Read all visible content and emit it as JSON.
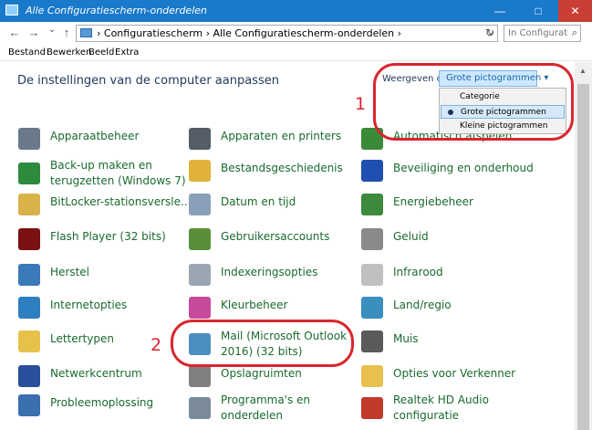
{
  "window": {
    "title": "Alle Configuratiescherm-onderdelen",
    "minimize": "—",
    "maximize": "□",
    "close": "✕"
  },
  "nav": {
    "back": "←",
    "forward": "→",
    "recent": "⌄",
    "up": "↑",
    "breadcrumb": "›  Configuratiescherm  ›  Alle Configuratiescherm-onderdelen  ›",
    "address_dropdown": "⌄",
    "refresh": "↻",
    "search_placeholder": "In Configurati...",
    "search_icon": "⌕"
  },
  "menu": [
    "Bestand",
    "Bewerken",
    "Beeld",
    "Extra"
  ],
  "heading": "De instellingen van de computer aanpassen",
  "view": {
    "label": "Weergeven op:",
    "selected": "Grote pictogrammen ▾",
    "options": [
      "Categorie",
      "Grote pictogrammen",
      "Kleine pictogrammen"
    ],
    "selected_index": 1
  },
  "items": [
    {
      "label": "Apparaatbeheer",
      "color": "#6b7a8a"
    },
    {
      "label": "Apparaten en printers",
      "color": "#555d66"
    },
    {
      "label": "Automatisch afspelen",
      "color": "#3a8a3a"
    },
    {
      "label": "Back-up maken en\nterugzetten (Windows 7)",
      "color": "#2e8b3e"
    },
    {
      "label": "Bestandsgeschiedenis",
      "color": "#e0b23a"
    },
    {
      "label": "Beveiliging en onderhoud",
      "color": "#1f4fb0"
    },
    {
      "label": "BitLocker-stationsversle...",
      "color": "#d9b24a"
    },
    {
      "label": "Datum en tijd",
      "color": "#8aa0b8"
    },
    {
      "label": "Energiebeheer",
      "color": "#3d8a3d"
    },
    {
      "label": "Flash Player (32 bits)",
      "color": "#7a1010"
    },
    {
      "label": "Gebruikersaccounts",
      "color": "#5a8f3a"
    },
    {
      "label": "Geluid",
      "color": "#8a8a8a"
    },
    {
      "label": "Herstel",
      "color": "#3a7ab8"
    },
    {
      "label": "Indexeringsopties",
      "color": "#9aa6b2"
    },
    {
      "label": "Infrarood",
      "color": "#c0c0c0"
    },
    {
      "label": "Internetopties",
      "color": "#2e7fbf"
    },
    {
      "label": "Kleurbeheer",
      "color": "#c84a9a"
    },
    {
      "label": "Land/regio",
      "color": "#3a8fbf"
    },
    {
      "label": "Lettertypen",
      "color": "#e6c24a"
    },
    {
      "label": "Mail (Microsoft Outlook\n2016) (32 bits)",
      "color": "#4a8fc0"
    },
    {
      "label": "Muis",
      "color": "#5a5a5a"
    },
    {
      "label": "Netwerkcentrum",
      "color": "#2a4f9a"
    },
    {
      "label": "Opslagruimten",
      "color": "#808080"
    },
    {
      "label": "Opties voor Verkenner",
      "color": "#e8c050"
    },
    {
      "label": "Probleemoplossing",
      "color": "#3a6fb0"
    },
    {
      "label": "Programma's en\nonderdelen",
      "color": "#7a8a9a"
    },
    {
      "label": "Realtek HD Audio\nconfiguratie",
      "color": "#c0392b"
    }
  ],
  "annotations": {
    "one": "1",
    "two": "2"
  },
  "scrollbar": {
    "up": "▲",
    "down": "▼"
  }
}
